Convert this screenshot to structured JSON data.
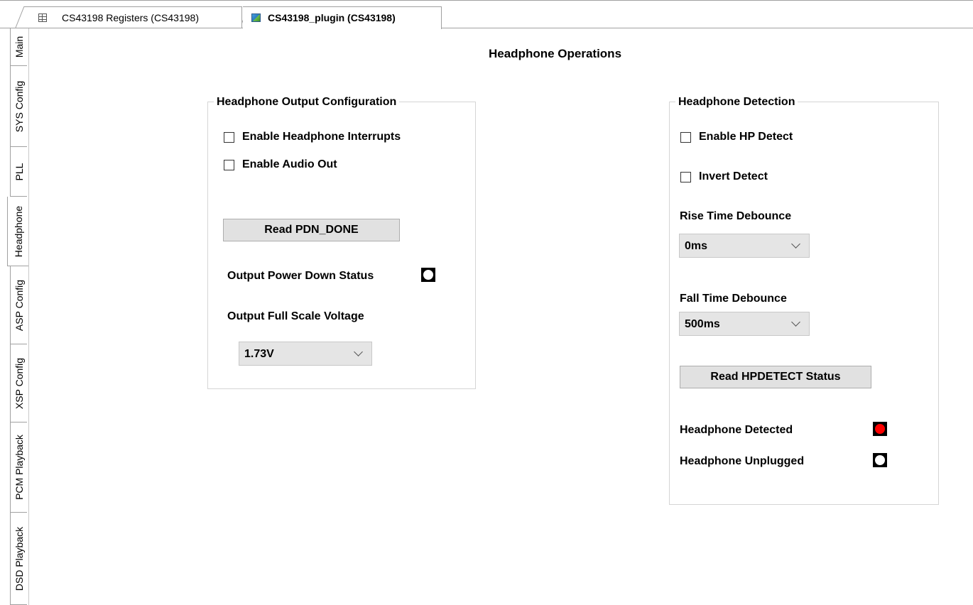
{
  "doc_tabs": [
    {
      "label": "CS43198 Registers (CS43198)",
      "icon": "table-icon"
    },
    {
      "label": "CS43198_plugin (CS43198)",
      "icon": "plugin-icon"
    }
  ],
  "side_tabs": [
    "Main",
    "SYS Config",
    "PLL",
    "Headphone",
    "ASP Config",
    "XSP Config",
    "PCM Playback",
    "DSD Playback"
  ],
  "active_side_tab": "Headphone",
  "page": {
    "title": "Headphone Operations"
  },
  "output_config": {
    "title": "Headphone Output Configuration",
    "enable_interrupts": "Enable Headphone Interrupts",
    "enable_audio_out": "Enable Audio Out",
    "read_pdn_button": "Read PDN_DONE",
    "power_down_status_label": "Output Power Down Status",
    "full_scale_label": "Output Full Scale Voltage",
    "full_scale_value": "1.73V"
  },
  "detection": {
    "title": "Headphone Detection",
    "enable_hp_detect": "Enable HP Detect",
    "invert_detect": "Invert Detect",
    "rise_label": "Rise Time Debounce",
    "rise_value": "0ms",
    "fall_label": "Fall Time Debounce",
    "fall_value": "500ms",
    "read_status_button": "Read HPDETECT Status",
    "detected_label": "Headphone Detected",
    "unplugged_label": "Headphone Unplugged"
  },
  "colors": {
    "led_on": "#ff0000",
    "led_off": "#ffffff"
  }
}
